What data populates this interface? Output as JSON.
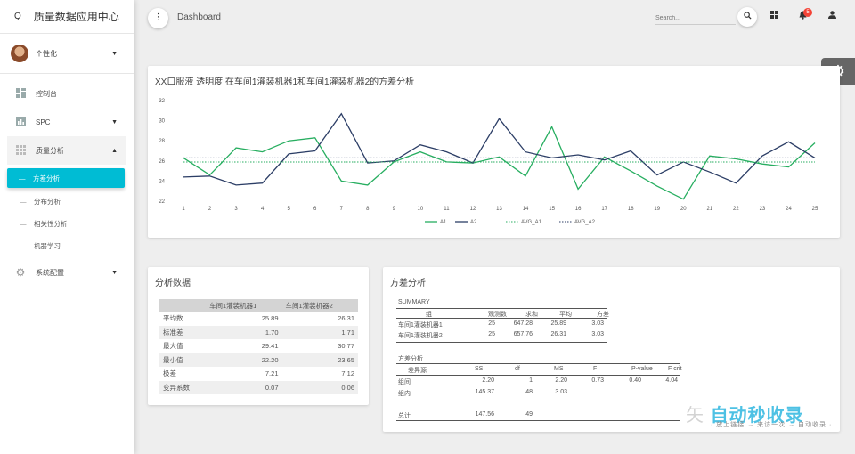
{
  "app": {
    "title": "质量数据应用中心",
    "logo_glyph": "Q"
  },
  "user": {
    "label": "个性化"
  },
  "sidebar": {
    "items": [
      {
        "label": "控制台",
        "icon": "dashboard-icon"
      },
      {
        "label": "SPC",
        "icon": "bar-chart-icon"
      },
      {
        "label": "质量分析",
        "icon": "grid-icon"
      },
      {
        "label": "系统配置",
        "icon": "gear-icon"
      }
    ],
    "sub_items": [
      {
        "label": "方差分析",
        "active": true
      },
      {
        "label": "分布分析"
      },
      {
        "label": "相关性分析"
      },
      {
        "label": "机器学习"
      }
    ]
  },
  "topbar": {
    "page_title": "Dashboard",
    "search_placeholder": "Search...",
    "notification_count": "5"
  },
  "chart_card": {
    "title": "XX口服液 透明度 在车间1灌装机器1和车间1灌装机器2的方差分析"
  },
  "chart_data": {
    "type": "line",
    "x": [
      1,
      2,
      3,
      4,
      5,
      6,
      7,
      8,
      9,
      10,
      11,
      12,
      13,
      14,
      15,
      16,
      17,
      18,
      19,
      20,
      21,
      22,
      23,
      24,
      25
    ],
    "ylim": [
      22,
      32
    ],
    "yticks": [
      22,
      24,
      26,
      28,
      30,
      32
    ],
    "legend_position": "bottom",
    "grid": false,
    "series": [
      {
        "name": "A1",
        "color": "#27ae60",
        "style": "solid",
        "values": [
          26.3,
          24.6,
          27.3,
          26.9,
          28.0,
          28.3,
          24.0,
          23.6,
          25.9,
          26.9,
          25.9,
          25.8,
          26.4,
          24.5,
          29.4,
          23.2,
          26.4,
          25.0,
          23.5,
          22.2,
          26.5,
          26.2,
          25.7,
          25.4,
          27.8
        ]
      },
      {
        "name": "A2",
        "color": "#2c3e66",
        "style": "solid",
        "values": [
          24.4,
          24.5,
          23.6,
          23.8,
          26.7,
          27.0,
          30.7,
          25.8,
          26.0,
          27.6,
          26.9,
          25.8,
          30.2,
          26.9,
          26.3,
          26.6,
          26.1,
          27.0,
          24.6,
          25.9,
          24.9,
          23.8,
          26.5,
          27.9,
          26.3
        ]
      },
      {
        "name": "AVG_A1",
        "color": "#27ae60",
        "style": "dotted",
        "values": [
          25.89,
          25.89,
          25.89,
          25.89,
          25.89,
          25.89,
          25.89,
          25.89,
          25.89,
          25.89,
          25.89,
          25.89,
          25.89,
          25.89,
          25.89,
          25.89,
          25.89,
          25.89,
          25.89,
          25.89,
          25.89,
          25.89,
          25.89,
          25.89,
          25.89
        ]
      },
      {
        "name": "AVG_A2",
        "color": "#2c3e66",
        "style": "dotted",
        "values": [
          26.31,
          26.31,
          26.31,
          26.31,
          26.31,
          26.31,
          26.31,
          26.31,
          26.31,
          26.31,
          26.31,
          26.31,
          26.31,
          26.31,
          26.31,
          26.31,
          26.31,
          26.31,
          26.31,
          26.31,
          26.31,
          26.31,
          26.31,
          26.31,
          26.31
        ]
      }
    ]
  },
  "stats_card": {
    "title": "分析数据",
    "headers": [
      "",
      "车间1灌装机器1",
      "车间1灌装机器2"
    ],
    "rows": [
      [
        "平均数",
        "25.89",
        "26.31"
      ],
      [
        "标准差",
        "1.70",
        "1.71"
      ],
      [
        "最大值",
        "29.41",
        "30.77"
      ],
      [
        "最小值",
        "22.20",
        "23.65"
      ],
      [
        "极差",
        "7.21",
        "7.12"
      ],
      [
        "变异系数",
        "0.07",
        "0.06"
      ]
    ]
  },
  "anova_card": {
    "title": "方差分析",
    "summary_label": "SUMMARY",
    "summary_headers": [
      "组",
      "观测数",
      "求和",
      "平均",
      "方差"
    ],
    "summary_rows": [
      [
        "车间1灌装机器1",
        "25",
        "647.28",
        "25.89",
        "3.03"
      ],
      [
        "车间1灌装机器2",
        "25",
        "657.76",
        "26.31",
        "3.03"
      ]
    ],
    "anova_label": "方差分析",
    "anova_headers": [
      "差异源",
      "SS",
      "df",
      "MS",
      "F",
      "P-value",
      "F crit"
    ],
    "anova_rows": [
      [
        "组间",
        "2.20",
        "1",
        "2.20",
        "0.73",
        "0.40",
        "4.04"
      ],
      [
        "组内",
        "145.37",
        "48",
        "3.03",
        "",
        "",
        ""
      ],
      [
        "",
        "",
        "",
        "",
        "",
        "",
        ""
      ],
      [
        "总计",
        "147.56",
        "49",
        "",
        "",
        "",
        ""
      ]
    ]
  },
  "watermark": {
    "text": "自动秒收录",
    "sub": "· 放上链接 → 来访一次 → 自动收录 ·",
    "glyph": "矢"
  }
}
